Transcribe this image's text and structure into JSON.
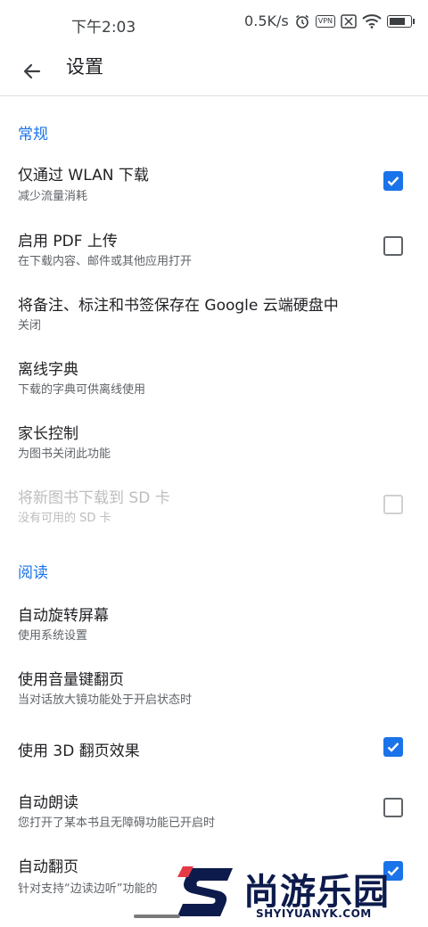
{
  "status_bar": {
    "time": "下午2:03",
    "net_speed": "0.5K/s",
    "icons": [
      "alarm-icon",
      "vpn-icon",
      "sim-off-icon",
      "wifi-icon",
      "battery-icon"
    ],
    "vpn_label": "VPN",
    "battery_level": 0.75
  },
  "app_bar": {
    "title": "设置",
    "back_icon": "arrow-back-icon"
  },
  "sections": {
    "general": {
      "header": "常规",
      "items": [
        {
          "title": "仅通过 WLAN 下载",
          "subtitle": "减少流量消耗",
          "control": "checkbox",
          "checked": true
        },
        {
          "title": "启用 PDF 上传",
          "subtitle": "在下载内容、邮件或其他应用打开",
          "control": "checkbox",
          "checked": false
        },
        {
          "title": "将备注、标注和书签保存在 Google 云端硬盘中",
          "subtitle": "关闭"
        },
        {
          "title": "离线字典",
          "subtitle": "下载的字典可供离线使用"
        },
        {
          "title": "家长控制",
          "subtitle": "为图书关闭此功能"
        },
        {
          "title": "将新图书下载到 SD 卡",
          "subtitle": "没有可用的 SD 卡",
          "control": "checkbox",
          "checked": false,
          "disabled": true
        }
      ]
    },
    "reading": {
      "header": "阅读",
      "items": [
        {
          "title": "自动旋转屏幕",
          "subtitle": "使用系统设置"
        },
        {
          "title": "使用音量键翻页",
          "subtitle": "当对话放大镜功能处于开启状态时"
        },
        {
          "title": "使用 3D 翻页效果",
          "control": "checkbox",
          "checked": true
        },
        {
          "title": "自动朗读",
          "subtitle": "您打开了某本书且无障碍功能已开启时",
          "control": "checkbox",
          "checked": false
        },
        {
          "title": "自动翻页",
          "subtitle": "针对支持“边读边听”功能的",
          "control": "checkbox",
          "checked": true
        }
      ]
    }
  },
  "watermark": {
    "text": "尚游乐园",
    "sub": "SHYIYUANYK.COM"
  },
  "colors": {
    "accent": "#1a73e8",
    "text_primary": "#202124",
    "text_secondary": "#5f6368",
    "disabled": "#bdbdbd"
  }
}
